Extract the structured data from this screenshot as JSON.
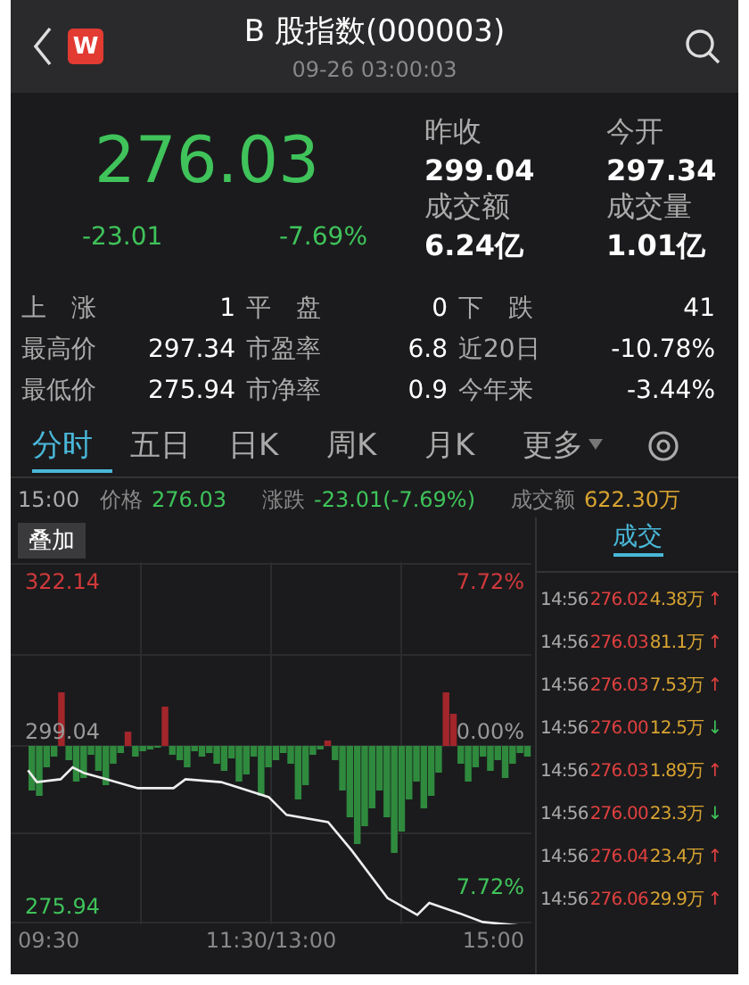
{
  "header": {
    "logo": "W",
    "title": "B 股指数(000003)",
    "time": "09-26 03:00:03"
  },
  "quote": {
    "rising": false,
    "price": "276.03",
    "change": "-23.01",
    "change_pct": "-7.69%",
    "fields": [
      {
        "label": "昨收",
        "value": "299.04"
      },
      {
        "label": "今开",
        "value": "297.34"
      },
      {
        "label": "成交额",
        "value": "6.24亿"
      },
      {
        "label": "成交量",
        "value": "1.01亿"
      }
    ]
  },
  "stats": [
    [
      {
        "label": "上　涨",
        "value": "1"
      },
      {
        "label": "平　盘",
        "value": "0"
      },
      {
        "label": "下　跌",
        "value": "41"
      }
    ],
    [
      {
        "label": "最高价",
        "value": "297.34"
      },
      {
        "label": "市盈率",
        "value": "6.8"
      },
      {
        "label": "近20日",
        "value": "-10.78%"
      }
    ],
    [
      {
        "label": "最低价",
        "value": "275.94"
      },
      {
        "label": "市净率",
        "value": "0.9"
      },
      {
        "label": "今年来",
        "value": "-3.44%"
      }
    ]
  ],
  "tabs": [
    {
      "label": "分时",
      "selected": true,
      "kind": "tab"
    },
    {
      "label": "五日",
      "selected": false,
      "kind": "tab"
    },
    {
      "label": "日K",
      "selected": false,
      "kind": "tab"
    },
    {
      "label": "周K",
      "selected": false,
      "kind": "tab"
    },
    {
      "label": "月K",
      "selected": false,
      "kind": "tab"
    },
    {
      "label": "更多",
      "selected": false,
      "kind": "menu"
    }
  ],
  "info": {
    "time": "15:00",
    "price_label": "价格",
    "price": "276.03",
    "change_label": "涨跌",
    "change": "-23.01(-7.69%)",
    "amount_label": "成交额",
    "amount": "622.30万"
  },
  "chart": {
    "overlay_button": "叠加",
    "high": "322.14",
    "high_pct": "7.72%",
    "base": "299.04",
    "base_pct": "0.00%",
    "low": "275.94",
    "low_pct": "7.72%",
    "x_labels": [
      "09:30",
      "11:30/13:00",
      "15:00"
    ]
  },
  "trades": {
    "tab": "成交",
    "rows": [
      {
        "time": "14:56",
        "price": "276.02",
        "volume": "4.38万",
        "up": true,
        "arrow": "↑"
      },
      {
        "time": "14:56",
        "price": "276.03",
        "volume": "81.1万",
        "up": true,
        "arrow": "↑"
      },
      {
        "time": "14:56",
        "price": "276.03",
        "volume": "7.53万",
        "up": true,
        "arrow": "↑"
      },
      {
        "time": "14:56",
        "price": "276.00",
        "volume": "12.5万",
        "up": false,
        "arrow": "↓"
      },
      {
        "time": "14:56",
        "price": "276.03",
        "volume": "1.89万",
        "up": true,
        "arrow": "↑"
      },
      {
        "time": "14:56",
        "price": "276.00",
        "volume": "23.3万",
        "up": false,
        "arrow": "↓"
      },
      {
        "time": "14:56",
        "price": "276.04",
        "volume": "23.4万",
        "up": true,
        "arrow": "↑"
      },
      {
        "time": "14:56",
        "price": "276.06",
        "volume": "29.9万",
        "up": true,
        "arrow": "↑"
      }
    ]
  }
}
